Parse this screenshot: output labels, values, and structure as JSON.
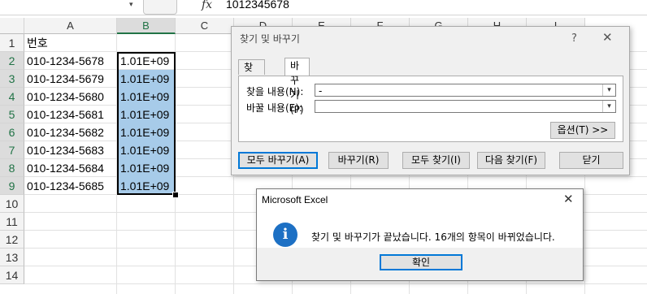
{
  "formula_bar": {
    "formula_value": "1012345678",
    "fx_label": "fx",
    "name_box_arrow": "▾"
  },
  "columns": [
    "A",
    "B",
    "C",
    "D",
    "E",
    "F",
    "G",
    "H",
    "I"
  ],
  "selected_column": "B",
  "rows": [
    {
      "num": "1",
      "a": "번호",
      "b": ""
    },
    {
      "num": "2",
      "a": "010-1234-5678",
      "b": "1.01E+09"
    },
    {
      "num": "3",
      "a": "010-1234-5679",
      "b": "1.01E+09"
    },
    {
      "num": "4",
      "a": "010-1234-5680",
      "b": "1.01E+09"
    },
    {
      "num": "5",
      "a": "010-1234-5681",
      "b": "1.01E+09"
    },
    {
      "num": "6",
      "a": "010-1234-5682",
      "b": "1.01E+09"
    },
    {
      "num": "7",
      "a": "010-1234-5683",
      "b": "1.01E+09"
    },
    {
      "num": "8",
      "a": "010-1234-5684",
      "b": "1.01E+09"
    },
    {
      "num": "9",
      "a": "010-1234-5685",
      "b": "1.01E+09"
    },
    {
      "num": "10",
      "a": "",
      "b": ""
    },
    {
      "num": "11",
      "a": "",
      "b": ""
    },
    {
      "num": "12",
      "a": "",
      "b": ""
    },
    {
      "num": "13",
      "a": "",
      "b": ""
    },
    {
      "num": "14",
      "a": "",
      "b": ""
    }
  ],
  "find_dialog": {
    "title": "찾기 및 바꾸기",
    "help": "?",
    "close": "✕",
    "tabs": [
      "찾기(D)",
      "바꾸기(P)"
    ],
    "find_label": "찾을 내용(N):",
    "find_value": "-",
    "replace_label": "바꿀 내용(E):",
    "replace_value": "",
    "options_button": "옵션(T) >>",
    "buttons": [
      "모두 바꾸기(A)",
      "바꾸기(R)",
      "모두 찾기(I)",
      "다음 찾기(F)",
      "닫기"
    ]
  },
  "message_box": {
    "title": "Microsoft Excel",
    "close": "✕",
    "icon": "i",
    "message": "찾기 및 바꾸기가 끝났습니다. 16개의 항목이 바뀌었습니다.",
    "ok_button": "확인"
  }
}
